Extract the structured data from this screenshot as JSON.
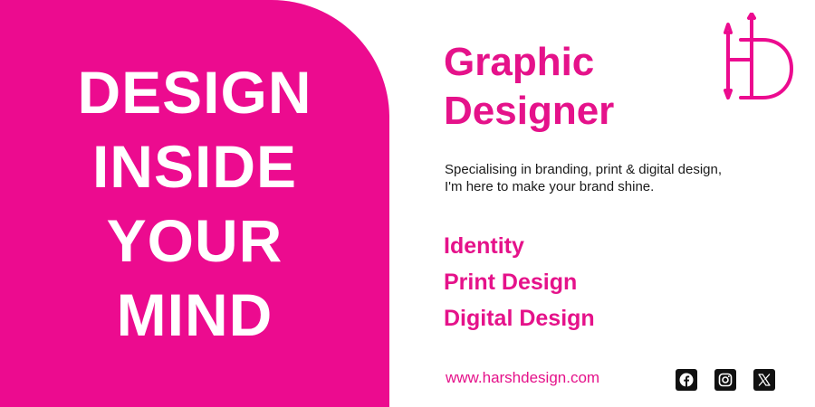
{
  "headline": {
    "lines": [
      "DESIGN",
      "INSIDE",
      "YOUR",
      "MIND"
    ]
  },
  "title": {
    "line1": "Graphic",
    "line2": "Designer"
  },
  "tagline": {
    "line1": "Specialising in branding, print & digital design,",
    "line2": "I'm here to make your brand shine."
  },
  "services": [
    "Identity",
    "Print Design",
    "Digital Design"
  ],
  "website": "www.harshdesign.com",
  "logo": {
    "icon": "hd-monogram-icon",
    "text": "HD"
  },
  "social": [
    "facebook-icon",
    "instagram-icon",
    "x-icon"
  ],
  "colors": {
    "accent": "#ec0b8f",
    "text_dark": "#1a1a1a",
    "panel_text": "#ffffff"
  }
}
